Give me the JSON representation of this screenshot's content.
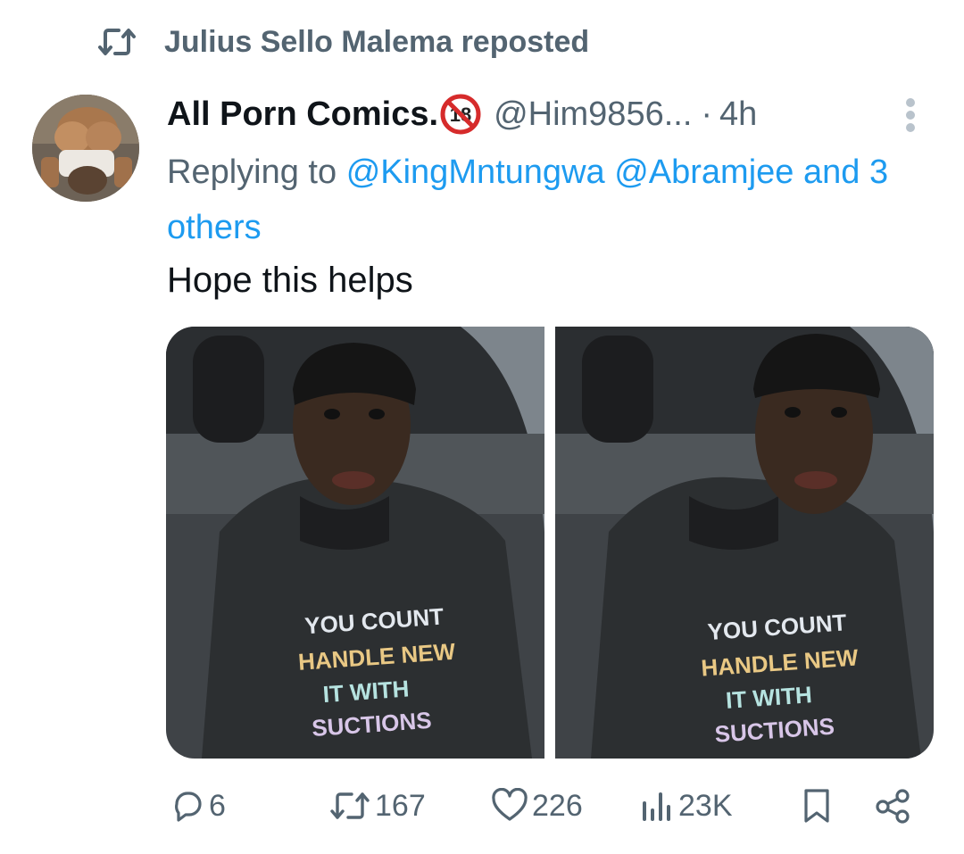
{
  "repost": {
    "text": "Julius Sello Malema reposted"
  },
  "author": {
    "name": "All Porn Comics.",
    "handle": "@Him9856...",
    "separator": "·",
    "time": "4h"
  },
  "replying": {
    "prefix": "Replying to",
    "mention1": "@KingMntungwa",
    "mention2": "@Abramjee",
    "others": "and 3 others"
  },
  "tweet": {
    "text": "Hope this helps"
  },
  "media": {
    "image1": {
      "shirt_lines": [
        "YOU COUNT",
        "HANDLE NEW",
        "IT WITH",
        "SUCTIONS"
      ]
    },
    "image2": {
      "shirt_lines": [
        "YOU COUNT",
        "HANDLE NEW",
        "IT WITH",
        "SUCTIONS"
      ]
    }
  },
  "actions": {
    "replies": "6",
    "reposts": "167",
    "likes": "226",
    "views": "23K"
  },
  "colors": {
    "secondary": "#536471",
    "accent": "#1d9bf0",
    "text": "#0f1419"
  },
  "icons": [
    "repost-icon",
    "avatar",
    "adult-content-badge-icon",
    "more-options-icon",
    "reply-icon",
    "repost-icon",
    "like-icon",
    "views-icon",
    "bookmark-icon",
    "share-icon"
  ]
}
